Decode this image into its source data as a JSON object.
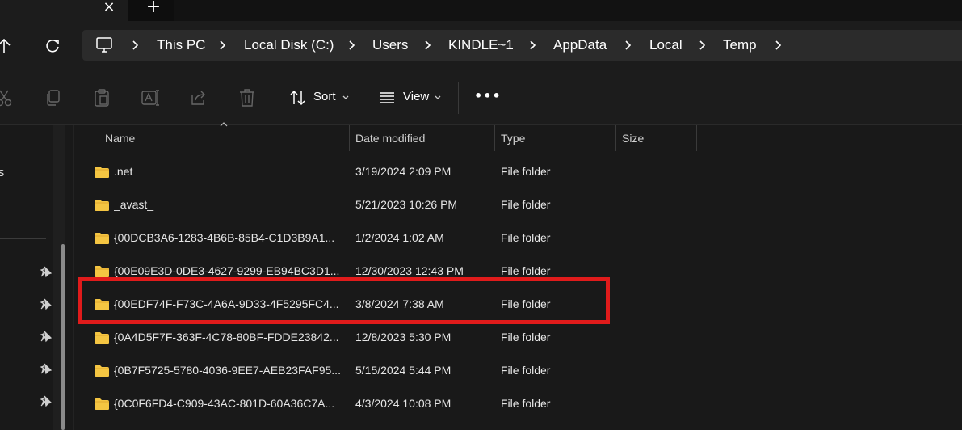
{
  "tabs": {
    "close_icon": "×",
    "new_tab_icon": "+"
  },
  "breadcrumb": {
    "items": [
      "This PC",
      "Local Disk (C:)",
      "Users",
      "KINDLE~1",
      "AppData",
      "Local",
      "Temp"
    ]
  },
  "toolbar": {
    "sort_label": "Sort",
    "view_label": "View",
    "more_label": "•••"
  },
  "nav": {
    "partial_label": "s"
  },
  "columns": {
    "name": "Name",
    "date": "Date modified",
    "type": "Type",
    "size": "Size"
  },
  "files": [
    {
      "name": ".net",
      "date": "3/19/2024 2:09 PM",
      "type": "File folder"
    },
    {
      "name": "_avast_",
      "date": "5/21/2023 10:26 PM",
      "type": "File folder"
    },
    {
      "name": "{00DCB3A6-1283-4B6B-85B4-C1D3B9A1...",
      "date": "1/2/2024 1:02 AM",
      "type": "File folder"
    },
    {
      "name": "{00E09E3D-0DE3-4627-9299-EB94BC3D1...",
      "date": "12/30/2023 12:43 PM",
      "type": "File folder"
    },
    {
      "name": "{00EDF74F-F73C-4A6A-9D33-4F5295FC4...",
      "date": "3/8/2024 7:38 AM",
      "type": "File folder"
    },
    {
      "name": "{0A4D5F7F-363F-4C78-80BF-FDDE23842...",
      "date": "12/8/2023 5:30 PM",
      "type": "File folder"
    },
    {
      "name": "{0B7F5725-5780-4036-9EE7-AEB23FAF95...",
      "date": "5/15/2024 5:44 PM",
      "type": "File folder"
    },
    {
      "name": "{0C0F6FD4-C909-43AC-801D-60A36C7A...",
      "date": "4/3/2024 10:08 PM",
      "type": "File folder"
    }
  ],
  "colors": {
    "folder": "#f4c542",
    "highlight": "#e01b1b",
    "background": "#191919"
  }
}
